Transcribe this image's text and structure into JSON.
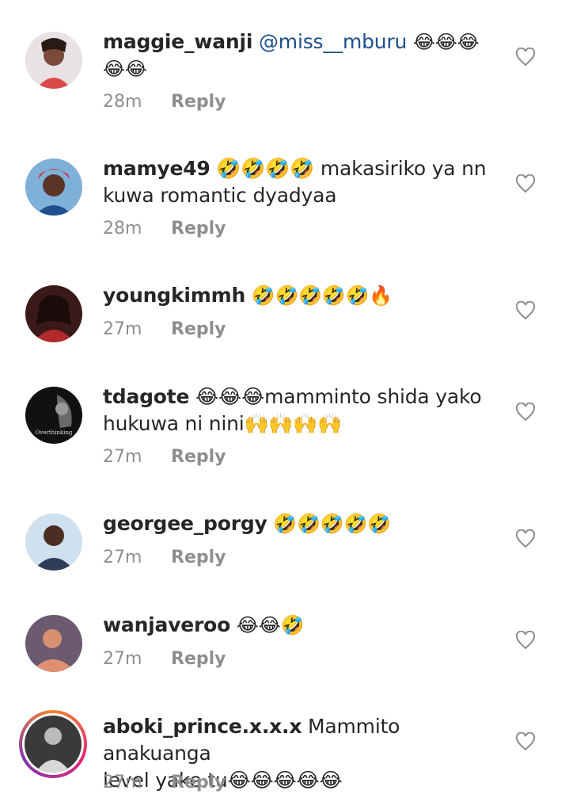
{
  "comments": [
    {
      "username": "maggie_wanji",
      "mention": "@miss__mburu",
      "text_line1": "😂😂😂",
      "text_line2": "😂😂",
      "time": "28m",
      "reply": "Reply"
    },
    {
      "username": "mamye49",
      "text_line1": "🤣🤣🤣🤣 makasiriko ya nn",
      "text_line2": "kuwa romantic dyadyaa",
      "time": "28m",
      "reply": "Reply"
    },
    {
      "username": "youngkimmh",
      "text_line1": "🤣🤣🤣🤣🤣🔥",
      "time": "27m",
      "reply": "Reply"
    },
    {
      "username": "tdagote",
      "text_line1": "😂😂😂mamminto shida yako",
      "text_line2": "hukuwa ni nini🙌🙌🙌🙌",
      "time": "27m",
      "reply": "Reply",
      "avatar_caption": "Overthinking"
    },
    {
      "username": "georgee_porgy",
      "text_line1": "🤣🤣🤣🤣🤣",
      "time": "27m",
      "reply": "Reply"
    },
    {
      "username": "wanjaveroo",
      "text_line1": "😂😂🤣",
      "time": "27m",
      "reply": "Reply"
    },
    {
      "username": "aboki_prince.x.x.x",
      "text_line1": "Mammito anakuanga",
      "text_line2": "level yake tu😂😂😂😂😂",
      "time": "27m",
      "reply": "Reply"
    }
  ],
  "icons": {
    "like": "heart-outline-icon"
  },
  "colors": {
    "mention": "#1d4f8c",
    "meta": "#8e8e8e",
    "text": "#262626"
  }
}
